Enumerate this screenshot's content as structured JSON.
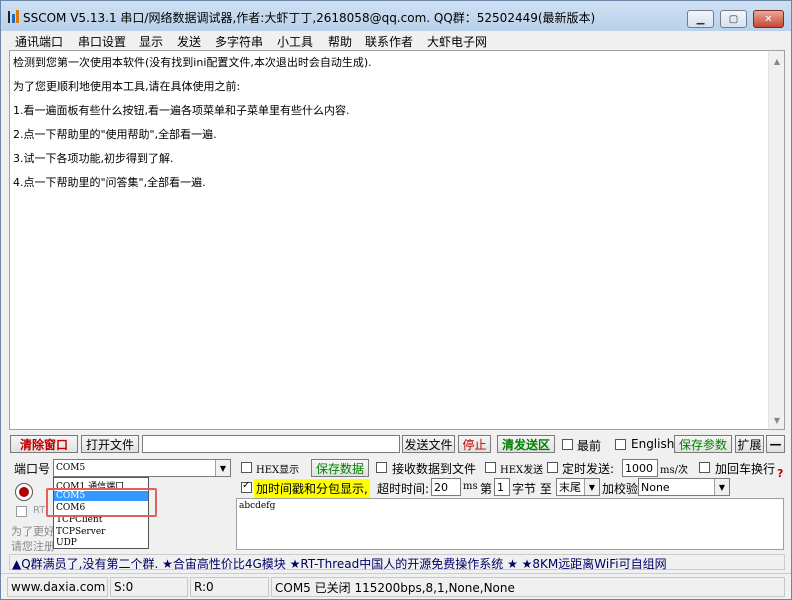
{
  "window": {
    "title": "SSCOM V5.13.1 串口/网络数据调试器,作者:大虾丁丁,2618058@qq.com. QQ群：52502449(最新版本)",
    "minimize_icon": "minimize-icon",
    "maximize_icon": "maximize-icon",
    "close_icon": "close-icon"
  },
  "menu": [
    "通讯端口",
    "串口设置",
    "显示",
    "发送",
    "多字符串",
    "小工具",
    "帮助",
    "联系作者",
    "大虾电子网"
  ],
  "log": {
    "lines": [
      "检测到您第一次使用本软件(没有找到ini配置文件,本次退出时会自动生成).",
      "为了您更顺利地使用本工具,请在具体使用之前:",
      "1.看一遍面板有些什么按钮,看一遍各项菜单和子菜单里有些什么内容.",
      "2.点一下帮助里的\"使用帮助\",全部看一遍.",
      "3.试一下各项功能,初步得到了解.",
      "4.点一下帮助里的\"问答集\",全部看一遍."
    ]
  },
  "toolbar": {
    "clear": "清除窗口",
    "open_file": "打开文件",
    "file_path": "",
    "send_file": "发送文件",
    "stop": "停止",
    "clear_send": "清发送区",
    "topmost": "最前",
    "english": "English",
    "save_params": "保存参数",
    "expand": "扩展",
    "collapse": "—"
  },
  "port_row": {
    "port_label": "端口号",
    "port_value": "COM5",
    "hex_display": "HEX显示",
    "save_data": "保存数据",
    "recv_to_file": "接收数据到文件",
    "hex_send": "HEX发送",
    "timed_send": "定时发送:",
    "interval": "1000",
    "unit": "ms/次",
    "add_crlf": "加回车换行",
    "help_mark": "?"
  },
  "options_row": {
    "timestamp": "加时间戳和分包显示,",
    "timeout_label": "超时时间:",
    "timeout": "20",
    "ms": "ms",
    "nth_label": "第",
    "nth": "1",
    "byte_to": "字节 至",
    "end": "末尾",
    "checksum_label": "加校验",
    "checksum": "None"
  },
  "port_dropdown": {
    "items": [
      "COM1 通信端口",
      "COM5",
      "COM6",
      "TCPClient",
      "TCPServer",
      "UDP"
    ],
    "selected_index": 1
  },
  "left_panel": {
    "partial_label": "RT",
    "partial_text1": "为了更好",
    "partial_text2": "请您注册"
  },
  "send_text": "abcdefg",
  "ticker": "▲Q群满员了,没有第二个群. ★合宙高性价比4G模块 ★RT-Thread中国人的开源免费操作系统 ★ ★8KM远距离WiFi可自组网",
  "status": {
    "website": "www.daxia.com",
    "sent": "S:0",
    "received": "R:0",
    "port_status": "COM5 已关闭  115200bps,8,1,None,None"
  },
  "colors": {
    "clear_button_text": "#c00000",
    "save_green": "#008000",
    "timestamp_bg": "#ffff00",
    "dropdown_selection": "#3399ff",
    "highlight_box": "#e06060"
  }
}
